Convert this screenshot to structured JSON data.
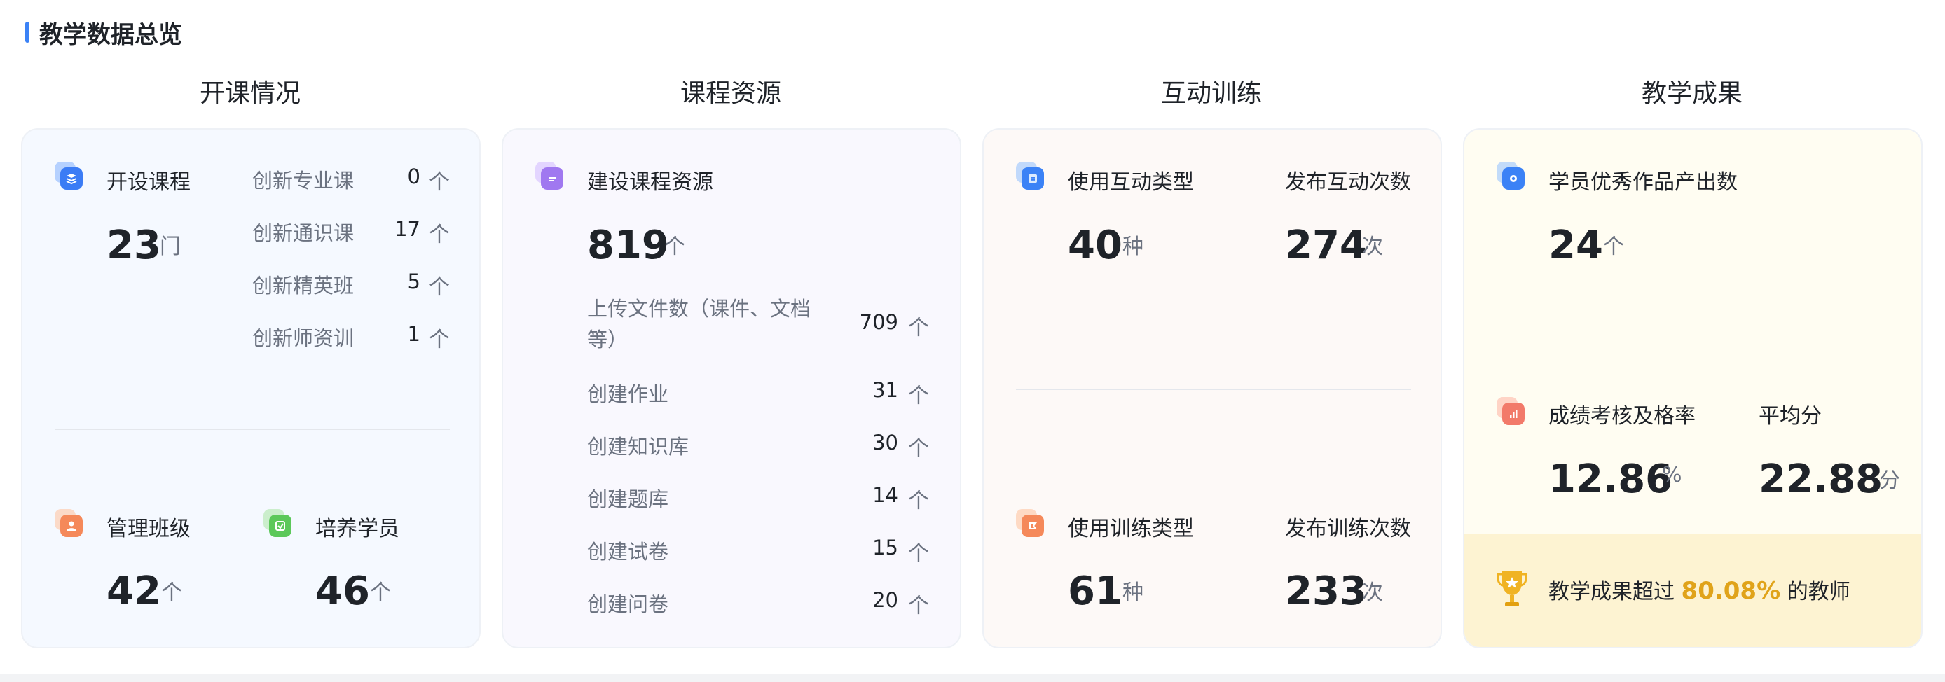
{
  "page": {
    "title": "教学数据总览"
  },
  "colors": {
    "accent": "#3b82f6",
    "highlight": "#e0a31a"
  },
  "columns": [
    {
      "title": "开课情况"
    },
    {
      "title": "课程资源"
    },
    {
      "title": "互动训练"
    },
    {
      "title": "教学成果"
    }
  ],
  "course": {
    "offered": {
      "label": "开设课程",
      "value": "23",
      "unit": "门",
      "icon": "course-book-icon"
    },
    "breakdown": [
      {
        "label": "创新专业课",
        "value": "0",
        "unit": "个"
      },
      {
        "label": "创新通识课",
        "value": "17",
        "unit": "个"
      },
      {
        "label": "创新精英班",
        "value": "5",
        "unit": "个"
      },
      {
        "label": "创新师资训",
        "value": "1",
        "unit": "个"
      }
    ],
    "classes": {
      "label": "管理班级",
      "value": "42",
      "unit": "个",
      "icon": "class-group-icon"
    },
    "students": {
      "label": "培养学员",
      "value": "46",
      "unit": "个",
      "icon": "student-icon"
    }
  },
  "resources": {
    "total": {
      "label": "建设课程资源",
      "value": "819",
      "unit": "个",
      "icon": "document-icon"
    },
    "items": [
      {
        "label": "上传文件数（课件、文档等）",
        "value": "709",
        "unit": "个"
      },
      {
        "label": "创建作业",
        "value": "31",
        "unit": "个"
      },
      {
        "label": "创建知识库",
        "value": "30",
        "unit": "个"
      },
      {
        "label": "创建题库",
        "value": "14",
        "unit": "个"
      },
      {
        "label": "创建试卷",
        "value": "15",
        "unit": "个"
      },
      {
        "label": "创建问卷",
        "value": "20",
        "unit": "个"
      }
    ]
  },
  "interaction": {
    "interact_types": {
      "label": "使用互动类型",
      "value": "40",
      "unit": "种",
      "icon": "interaction-icon"
    },
    "interact_count": {
      "label": "发布互动次数",
      "value": "274",
      "unit": "次"
    },
    "train_types": {
      "label": "使用训练类型",
      "value": "61",
      "unit": "种",
      "icon": "training-icon"
    },
    "train_count": {
      "label": "发布训练次数",
      "value": "233",
      "unit": "次"
    }
  },
  "outcomes": {
    "works": {
      "label": "学员优秀作品产出数",
      "value": "24",
      "unit": "个",
      "icon": "award-works-icon"
    },
    "pass_rate": {
      "label": "成绩考核及格率",
      "value": "12.86",
      "unit": "%",
      "icon": "score-chart-icon"
    },
    "avg_score": {
      "label": "平均分",
      "value": "22.88",
      "unit": "分"
    },
    "banner": {
      "prefix": "教学成果超过",
      "percent": "80.08%",
      "suffix": "的教师",
      "icon": "trophy-icon"
    }
  }
}
